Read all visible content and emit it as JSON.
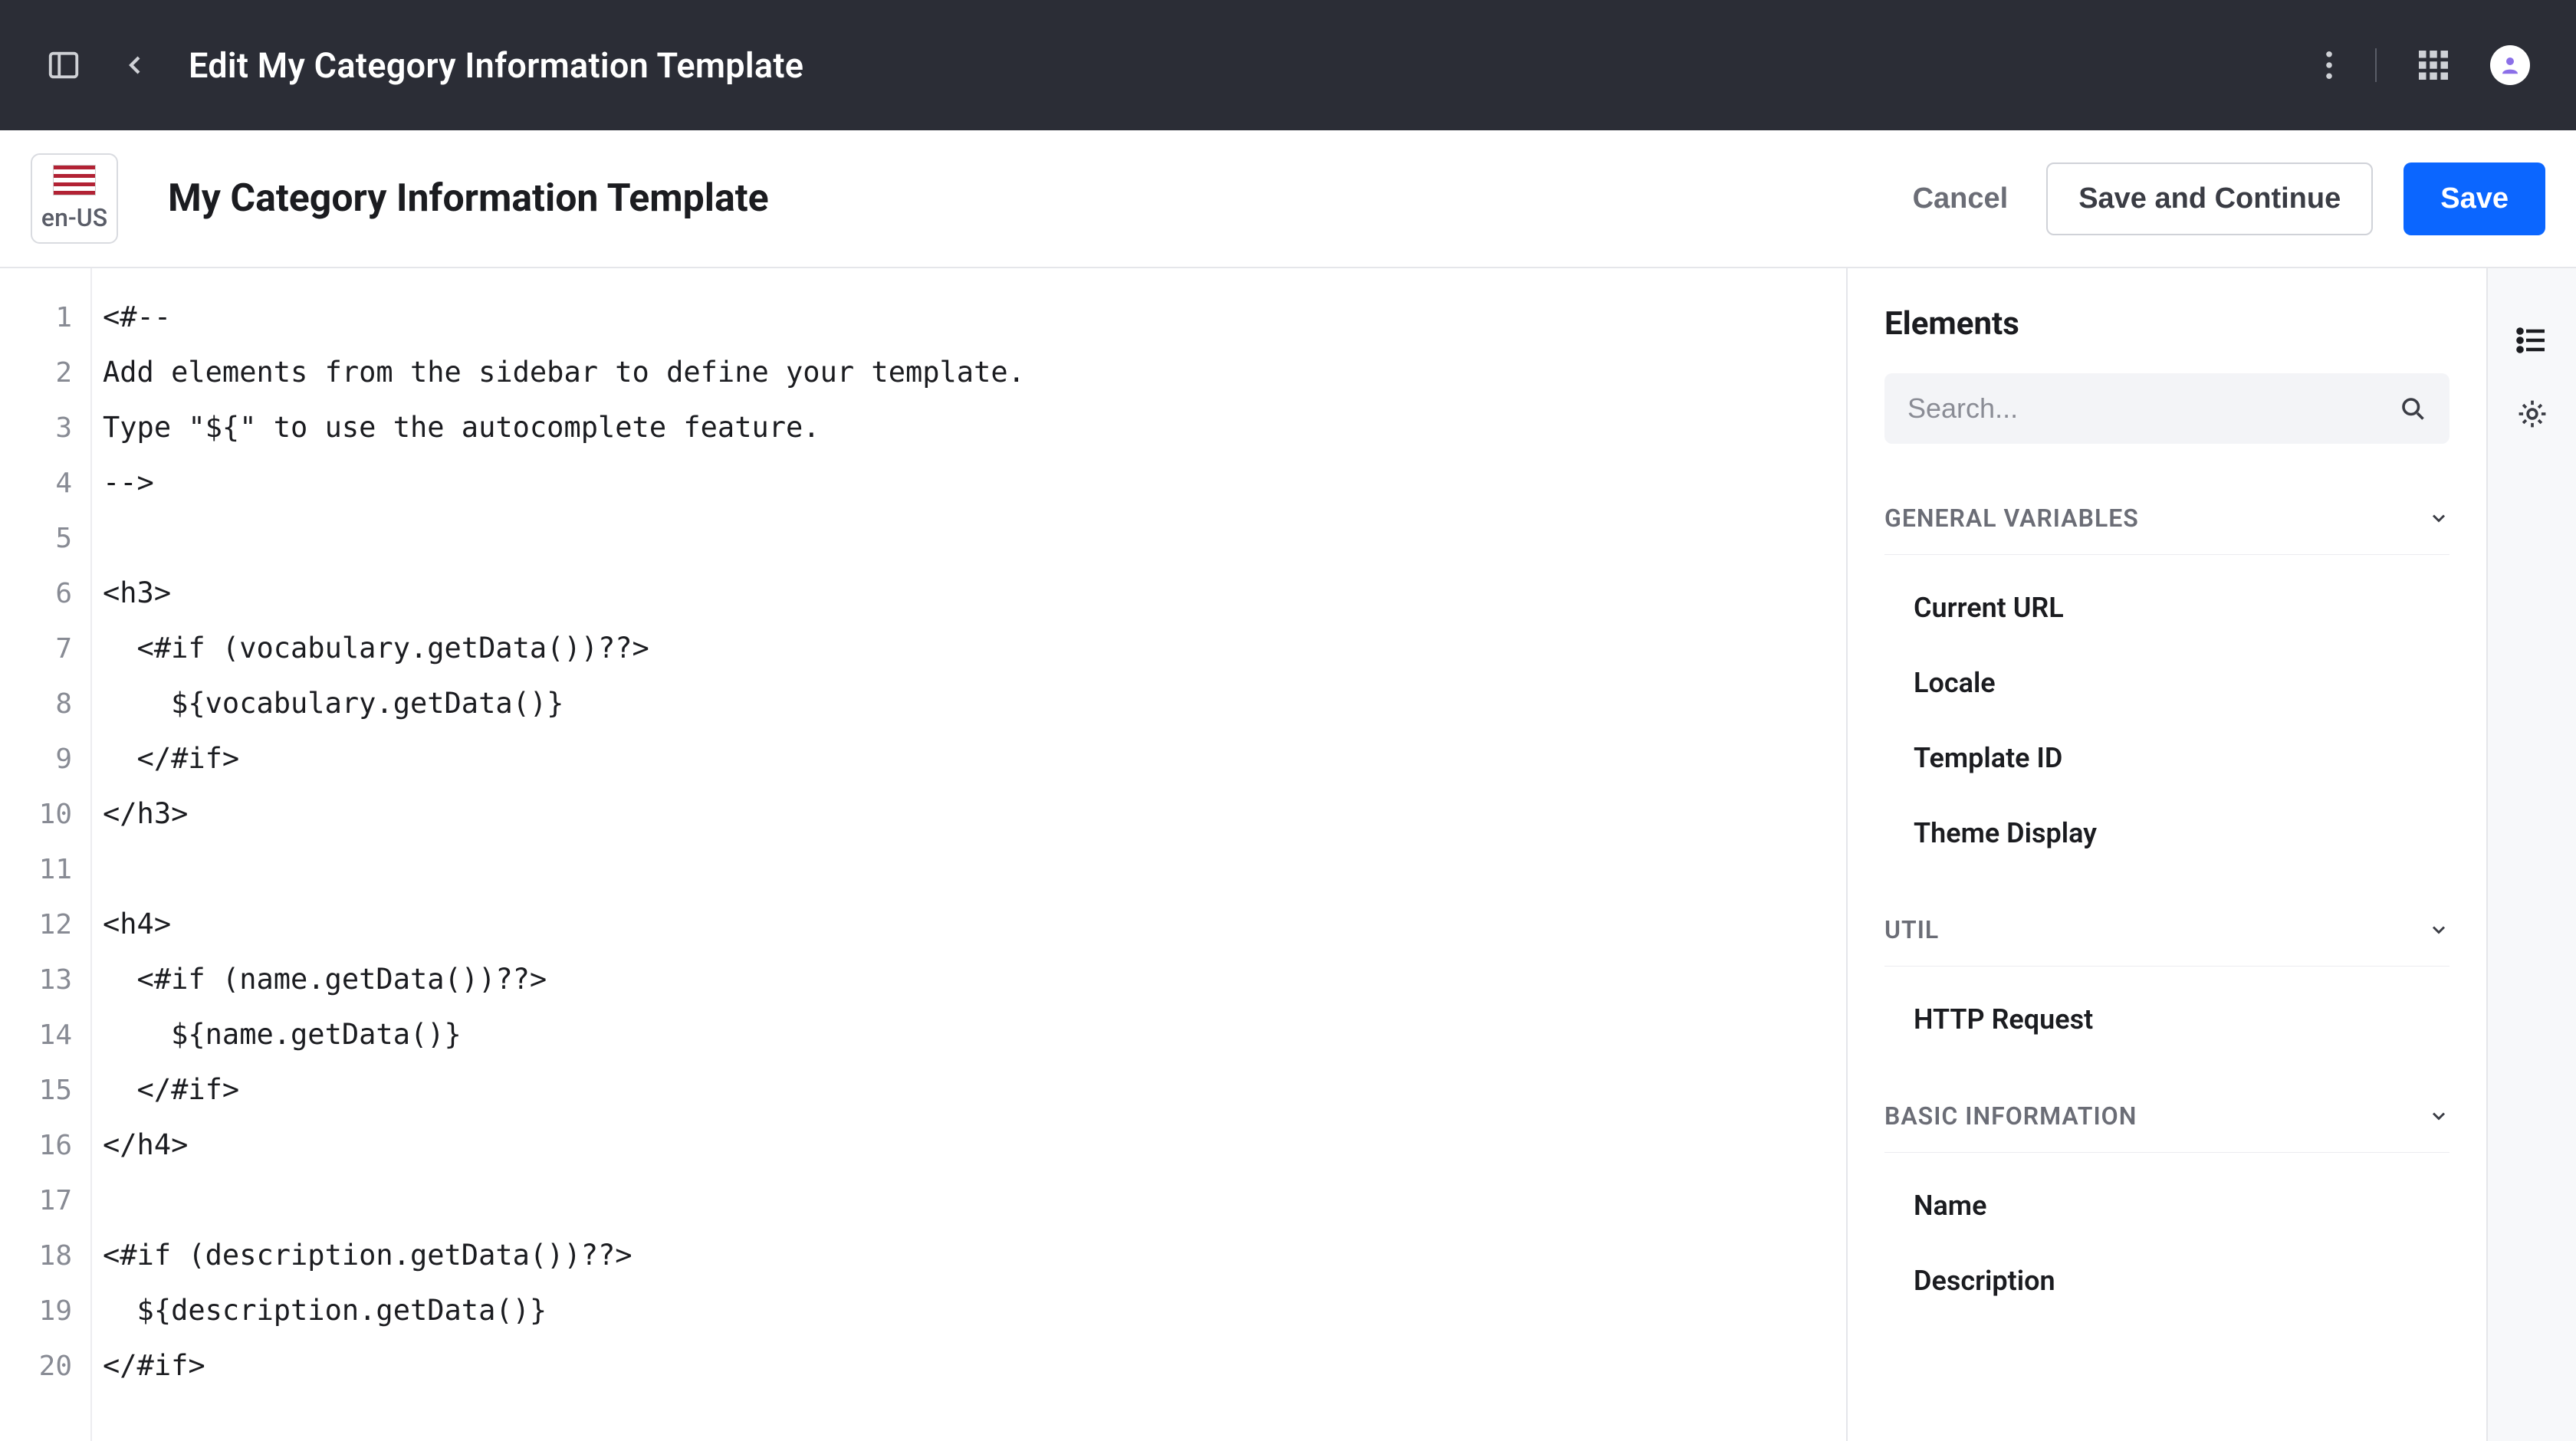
{
  "topbar": {
    "title": "Edit My Category Information Template"
  },
  "subheader": {
    "locale": "en-US",
    "title": "My Category Information Template",
    "cancel": "Cancel",
    "save_continue": "Save and Continue",
    "save": "Save"
  },
  "code_lines": [
    "<#--",
    "Add elements from the sidebar to define your template.",
    "Type \"${\" to use the autocomplete feature.",
    "-->",
    "",
    "<h3>",
    "  <#if (vocabulary.getData())??>",
    "    ${vocabulary.getData()}",
    "  </#if>",
    "</h3>",
    "",
    "<h4>",
    "  <#if (name.getData())??>",
    "    ${name.getData()}",
    "  </#if>",
    "</h4>",
    "",
    "<#if (description.getData())??>",
    "  ${description.getData()}",
    "</#if>"
  ],
  "sidebar": {
    "title": "Elements",
    "search_placeholder": "Search...",
    "sections": [
      {
        "label": "GENERAL VARIABLES",
        "items": [
          "Current URL",
          "Locale",
          "Template ID",
          "Theme Display"
        ]
      },
      {
        "label": "UTIL",
        "items": [
          "HTTP Request"
        ]
      },
      {
        "label": "BASIC INFORMATION",
        "items": [
          "Name",
          "Description"
        ]
      }
    ]
  }
}
